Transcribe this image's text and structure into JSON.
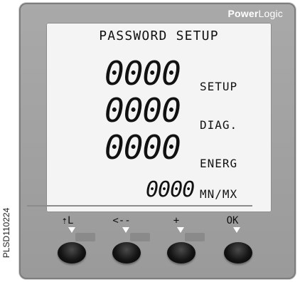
{
  "side_label": "PLSD110224",
  "brand": {
    "power": "Power",
    "logic": "Logic"
  },
  "screen": {
    "title": "PASSWORD SETUP",
    "rows": [
      {
        "value": "0000",
        "label": "SETUP"
      },
      {
        "value": "0000",
        "label": "DIAG."
      },
      {
        "value": "0000",
        "label": "ENERG"
      },
      {
        "value": "0000",
        "label": "MN/MX"
      }
    ]
  },
  "softkeys": [
    {
      "label": "⇡L",
      "icon": "up-arrow-icon"
    },
    {
      "label": "<--",
      "icon": "left-arrow-icon"
    },
    {
      "label": "+",
      "icon": "plus-icon"
    },
    {
      "label": "OK",
      "icon": "ok"
    }
  ]
}
